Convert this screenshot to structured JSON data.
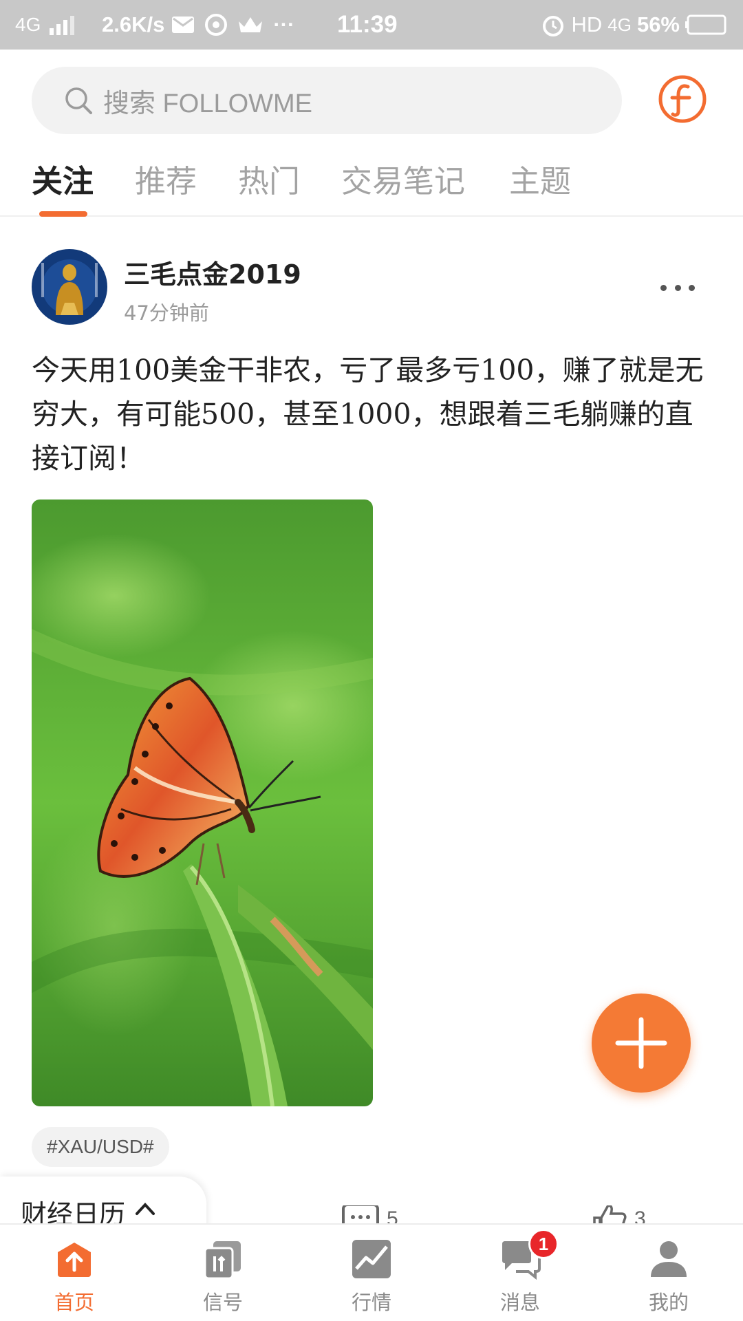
{
  "status_bar": {
    "network": "4G",
    "speed": "2.6K/s",
    "dots": "···",
    "time": "11:39",
    "hd": "HD",
    "network2": "4G",
    "battery": "56%"
  },
  "search": {
    "placeholder": "搜索 FOLLOWME"
  },
  "tabs": [
    {
      "label": "关注"
    },
    {
      "label": "推荐"
    },
    {
      "label": "热门"
    },
    {
      "label": "交易笔记"
    },
    {
      "label": "主题"
    }
  ],
  "post": {
    "author": "三毛点金2019",
    "time": "47分钟前",
    "body": "今天用100美金干非农，亏了最多亏100，赚了就是无穷大，有可能500，甚至1000，想跟着三毛躺赚的直接订阅！",
    "tag": "#XAU/USD#",
    "comments": "5",
    "likes": "3"
  },
  "calendar": {
    "label": "财经日历"
  },
  "bottom_nav": {
    "items": [
      {
        "label": "首页"
      },
      {
        "label": "信号"
      },
      {
        "label": "行情"
      },
      {
        "label": "消息",
        "badge": "1"
      },
      {
        "label": "我的"
      }
    ]
  },
  "colors": {
    "accent": "#f36c31",
    "badge": "#e8262a"
  }
}
